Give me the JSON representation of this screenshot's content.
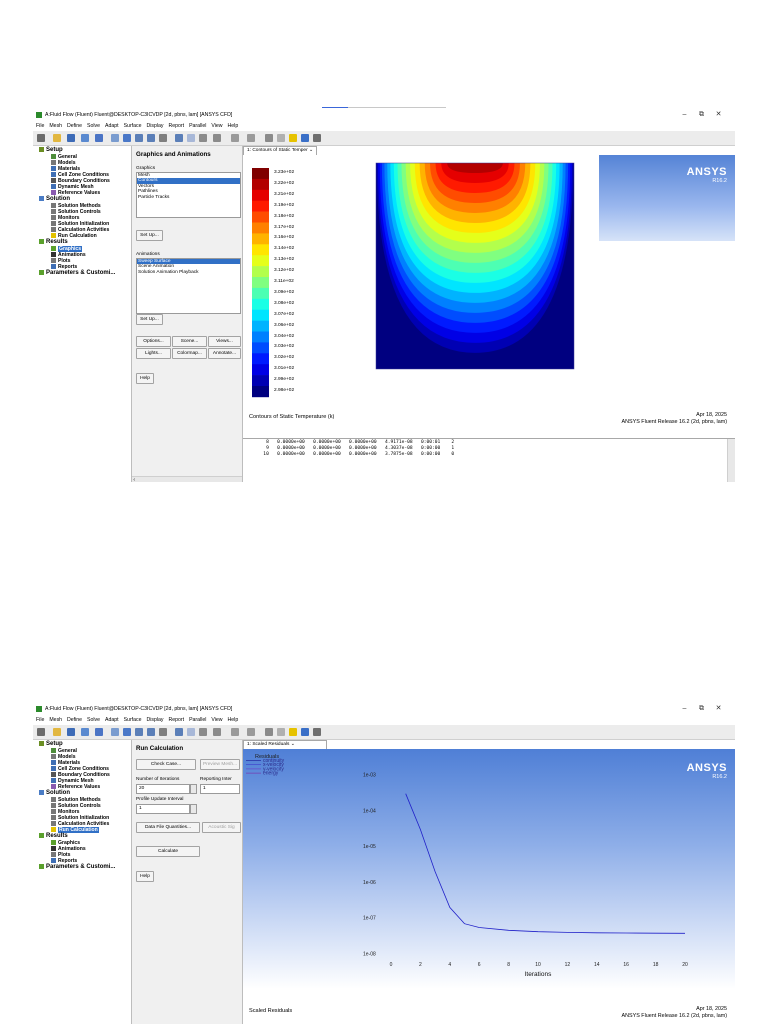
{
  "window1": {
    "title": "A:Fluid Flow (Fluent) Fluent@DESKTOP-C3ICVDP  [2d, pbns, lam] [ANSYS CFD]",
    "menu": [
      "File",
      "Mesh",
      "Define",
      "Solve",
      "Adapt",
      "Surface",
      "Display",
      "Report",
      "Parallel",
      "View",
      "Help"
    ],
    "tree": {
      "setup": "Setup",
      "general": "General",
      "models": "Models",
      "materials": "Materials",
      "cell_zone": "Cell Zone Conditions",
      "boundary": "Boundary Conditions",
      "dynamic_mesh": "Dynamic Mesh",
      "reference": "Reference Values",
      "solution": "Solution",
      "methods": "Solution Methods",
      "controls": "Solution Controls",
      "monitors": "Monitors",
      "init": "Solution Initialization",
      "calc_act": "Calculation Activities",
      "run_calc": "Run Calculation",
      "results": "Results",
      "graphics": "Graphics",
      "animations": "Animations",
      "plots": "Plots",
      "reports": "Reports",
      "params": "Parameters & Customi..."
    },
    "panel": {
      "title": "Graphics and Animations",
      "graphics_label": "Graphics",
      "graphics_items": [
        "Mesh",
        "Contours",
        "Vectors",
        "Pathlines",
        "Particle Tracks"
      ],
      "setup_btn": "Set Up...",
      "animations_label": "Animations",
      "animations_items": [
        "Sweep Surface",
        "Scene Animation",
        "Solution Animation Playback"
      ],
      "setup_btn2": "Set Up...",
      "options_btn": "Options...",
      "scene_btn": "Scene...",
      "views_btn": "Views...",
      "lights_btn": "Lights...",
      "colormap_btn": "Colormap...",
      "annotate_btn": "Annotate...",
      "help_btn": "Help"
    },
    "graphics": {
      "tab": "1: Contours of Static Temper",
      "ansys": "ANSYS",
      "release": "R16.2",
      "legend": [
        "3.23e+02",
        "3.22e+02",
        "3.21e+02",
        "3.19e+02",
        "3.18e+02",
        "3.17e+02",
        "3.16e+02",
        "3.14e+02",
        "3.13e+02",
        "3.12e+02",
        "3.11e+02",
        "3.09e+02",
        "3.08e+02",
        "3.07e+02",
        "3.06e+02",
        "3.04e+02",
        "3.03e+02",
        "3.02e+02",
        "3.01e+02",
        "2.99e+02",
        "2.98e+02"
      ],
      "caption": "Contours of Static Temperature (k)",
      "date": "Apr 18, 2025",
      "release_line": "ANSYS Fluent Release 16.2 (2d, pbns, lam)"
    },
    "console": [
      "    8   0.0000e+00   0.0000e+00   0.0000e+00   4.9171e-08   0:00:01    2",
      "    9   0.0000e+00   0.0000e+00   0.0000e+00   4.3037e-08   0:00:00    1",
      "   10   0.0000e+00   0.0000e+00   0.0000e+00   3.7875e-08   0:00:00    0"
    ]
  },
  "window2": {
    "title": "A:Fluid Flow (Fluent) Fluent@DESKTOP-C3ICVDP  [2d, pbns, lam] [ANSYS CFD]",
    "panel": {
      "title": "Run Calculation",
      "check_case": "Check Case...",
      "preview_mesh": "Preview Mesh...",
      "iter_label": "Number of Iterations",
      "iter_value": "20",
      "report_label": "Reporting Inter",
      "report_value": "1",
      "profile_label": "Profile Update Interval",
      "profile_value": "1",
      "data_file": "Data File Quantities...",
      "acoustic": "Acoustic Sig",
      "calculate": "Calculate",
      "help_btn": "Help"
    },
    "graphics": {
      "tab": "1: Scaled Residuals",
      "ansys": "ANSYS",
      "release": "R16.2",
      "caption": "Scaled Residuals",
      "date": "Apr 18, 2025",
      "release_line": "ANSYS Fluent Release 16.2 (2d, pbns, lam)"
    }
  },
  "chart_data": {
    "type": "line",
    "title": "",
    "xlabel": "Iterations",
    "ylabel": "",
    "xlim": [
      0,
      20
    ],
    "ylim_log10": [
      -8,
      -3
    ],
    "x_ticks": [
      "0",
      "2",
      "4",
      "6",
      "8",
      "10",
      "12",
      "14",
      "16",
      "18",
      "20"
    ],
    "y_ticks": [
      "1e-03",
      "1e-04",
      "1e-05",
      "1e-06",
      "1e-07",
      "1e-08"
    ],
    "legend_title": "Residuals",
    "legend": [
      "continuity",
      "x-velocity",
      "y-velocity",
      "energy"
    ],
    "series": [
      {
        "name": "energy",
        "color": "#2020c8",
        "x": [
          1,
          2,
          3,
          4,
          5,
          6,
          8,
          10,
          12,
          14,
          16,
          18,
          20
        ],
        "y": [
          0.0003,
          3e-05,
          2e-06,
          2e-07,
          7e-08,
          5.5e-08,
          4.6e-08,
          4.2e-08,
          4e-08,
          3.9e-08,
          3.85e-08,
          3.8e-08,
          3.79e-08
        ]
      }
    ]
  }
}
